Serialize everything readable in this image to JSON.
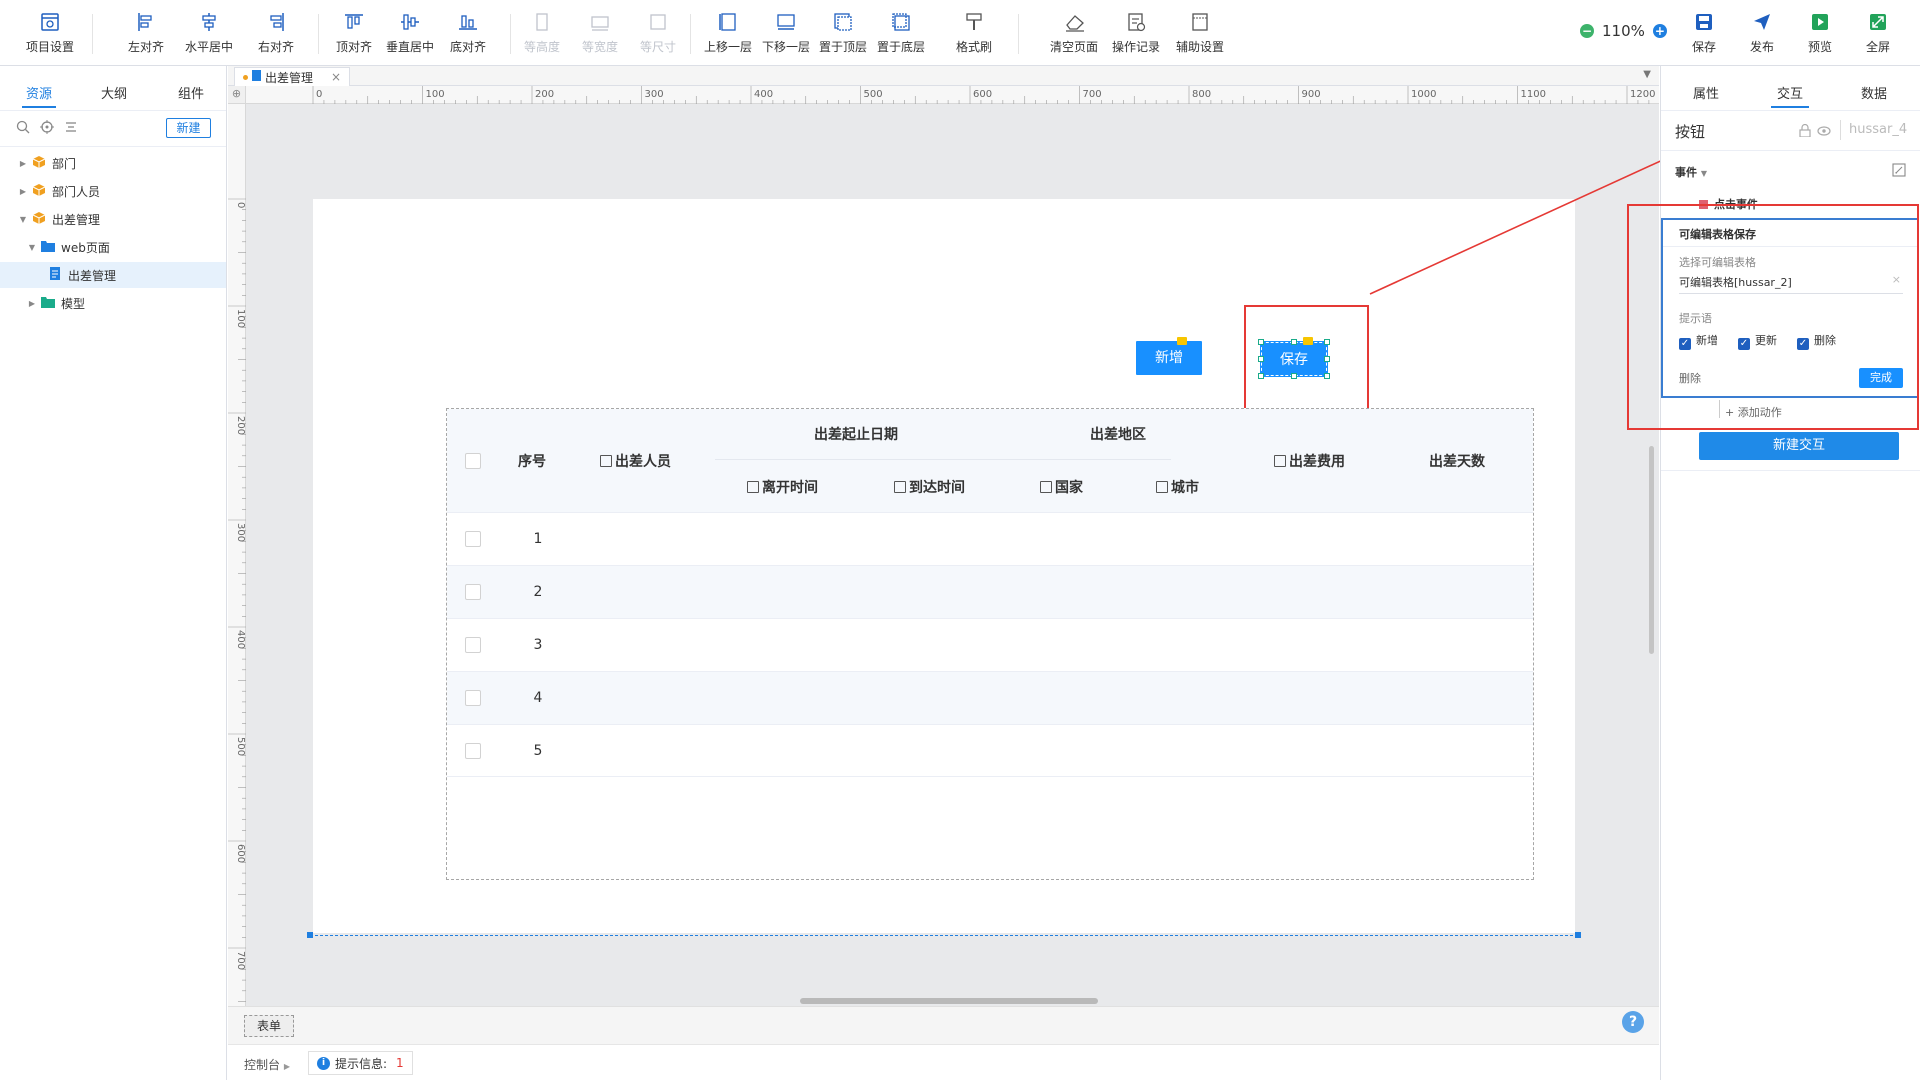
{
  "toolbar": {
    "items": [
      {
        "label": "项目设置",
        "icon": "project-settings-icon"
      },
      {
        "label": "左对齐",
        "icon": "align-left-icon"
      },
      {
        "label": "水平居中",
        "icon": "align-hcenter-icon"
      },
      {
        "label": "右对齐",
        "icon": "align-right-icon"
      },
      {
        "label": "顶对齐",
        "icon": "align-top-icon"
      },
      {
        "label": "垂直居中",
        "icon": "align-vcenter-icon"
      },
      {
        "label": "底对齐",
        "icon": "align-bottom-icon"
      },
      {
        "label": "等高度",
        "icon": "same-height-icon"
      },
      {
        "label": "等宽度",
        "icon": "same-width-icon"
      },
      {
        "label": "等尺寸",
        "icon": "same-size-icon"
      },
      {
        "label": "上移一层",
        "icon": "move-up-layer-icon"
      },
      {
        "label": "下移一层",
        "icon": "move-down-layer-icon"
      },
      {
        "label": "置于顶层",
        "icon": "bring-to-front-icon"
      },
      {
        "label": "置于底层",
        "icon": "send-to-back-icon"
      },
      {
        "label": "格式刷",
        "icon": "format-painter-icon"
      },
      {
        "label": "清空页面",
        "icon": "eraser-icon"
      },
      {
        "label": "操作记录",
        "icon": "history-icon"
      },
      {
        "label": "辅助设置",
        "icon": "guides-settings-icon"
      }
    ],
    "zoom": "110%",
    "right_actions": [
      {
        "label": "保存",
        "icon": "save-icon"
      },
      {
        "label": "发布",
        "icon": "publish-icon"
      },
      {
        "label": "预览",
        "icon": "preview-icon"
      },
      {
        "label": "全屏",
        "icon": "fullscreen-icon"
      }
    ]
  },
  "left_panel": {
    "tabs": [
      "资源",
      "大纲",
      "组件"
    ],
    "active_tab": "资源",
    "new_button": "新建",
    "tree": [
      {
        "label": "部门",
        "type": "module"
      },
      {
        "label": "部门人员",
        "type": "module"
      },
      {
        "label": "出差管理",
        "type": "module"
      },
      {
        "label": "web页面",
        "type": "folder"
      },
      {
        "label": "出差管理",
        "type": "page"
      },
      {
        "label": "模型",
        "type": "folder-teal"
      }
    ]
  },
  "editor": {
    "tab_label": "出差管理",
    "ruler_top": [
      "0",
      "100",
      "200",
      "300",
      "400",
      "500",
      "600",
      "700",
      "800",
      "900",
      "1000",
      "1100",
      "1200"
    ],
    "ruler_left": [
      "0",
      "100",
      "200",
      "300",
      "400",
      "500",
      "600",
      "700"
    ],
    "buttons": {
      "add": "新增",
      "save": "保存"
    },
    "table": {
      "group_headers": [
        "出差起止日期",
        "出差地区"
      ],
      "headers": [
        "序号",
        "出差人员",
        "离开时间",
        "到达时间",
        "国家",
        "城市",
        "出差费用",
        "出差天数"
      ],
      "rows": [
        "1",
        "2",
        "3",
        "4",
        "5"
      ]
    },
    "bottom_tab": "表单",
    "help": "?"
  },
  "status_bar": {
    "console": "控制台",
    "info_label": "提示信息:",
    "info_count": "1"
  },
  "right_panel": {
    "tabs": [
      "属性",
      "交互",
      "数据"
    ],
    "active_tab": "交互",
    "component_type": "按钮",
    "component_id": "hussar_4",
    "event_label": "事件",
    "event_name": "点击事件",
    "action": {
      "title": "可编辑表格保存",
      "select_label": "选择可编辑表格",
      "select_value": "可编辑表格[hussar_2]",
      "prompt_label": "提示语",
      "options": [
        "新增",
        "更新",
        "删除"
      ],
      "delete": "删除",
      "done": "完成"
    },
    "add_action": "添加动作",
    "new_interaction": "新建交互"
  },
  "colors": {
    "primary": "#1890ff",
    "highlight": "#e53935",
    "canvas_bg": "#e8e9eb"
  }
}
